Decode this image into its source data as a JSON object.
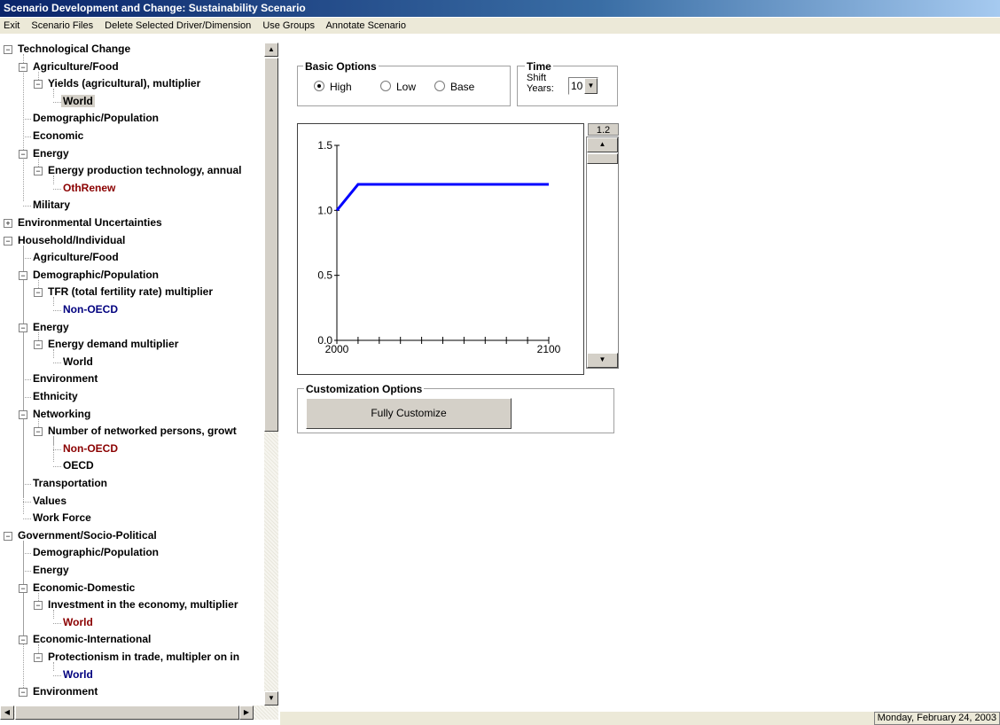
{
  "window": {
    "title": "Scenario Development and Change: Sustainability Scenario"
  },
  "menu": {
    "exit": "Exit",
    "scenario_files": "Scenario Files",
    "delete": "Delete Selected Driver/Dimension",
    "use_groups": "Use Groups",
    "annotate": "Annotate Scenario"
  },
  "tree": {
    "nodes": [
      {
        "label": "Technological Change",
        "depth": 0,
        "expander": "minus",
        "color": "black"
      },
      {
        "label": "Agriculture/Food",
        "depth": 1,
        "expander": "minus",
        "color": "black"
      },
      {
        "label": "Yields (agricultural), multiplier",
        "depth": 2,
        "expander": "minus",
        "color": "black"
      },
      {
        "label": "World",
        "depth": 3,
        "expander": "none",
        "color": "black",
        "selected": true
      },
      {
        "label": "Demographic/Population",
        "depth": 1,
        "expander": "none",
        "color": "black"
      },
      {
        "label": "Economic",
        "depth": 1,
        "expander": "none",
        "color": "black"
      },
      {
        "label": "Energy",
        "depth": 1,
        "expander": "minus",
        "color": "black"
      },
      {
        "label": "Energy production technology, annual",
        "depth": 2,
        "expander": "minus",
        "color": "black"
      },
      {
        "label": "OthRenew",
        "depth": 3,
        "expander": "none",
        "color": "red"
      },
      {
        "label": "Military",
        "depth": 1,
        "expander": "none",
        "color": "black"
      },
      {
        "label": "Environmental Uncertainties",
        "depth": 0,
        "expander": "plus",
        "color": "black"
      },
      {
        "label": "Household/Individual",
        "depth": 0,
        "expander": "minus",
        "color": "black"
      },
      {
        "label": "Agriculture/Food",
        "depth": 1,
        "expander": "none",
        "color": "black"
      },
      {
        "label": "Demographic/Population",
        "depth": 1,
        "expander": "minus",
        "color": "black"
      },
      {
        "label": "TFR (total fertility rate) multiplier",
        "depth": 2,
        "expander": "minus",
        "color": "black"
      },
      {
        "label": "Non-OECD",
        "depth": 3,
        "expander": "none",
        "color": "blue"
      },
      {
        "label": "Energy",
        "depth": 1,
        "expander": "minus",
        "color": "black"
      },
      {
        "label": "Energy demand multiplier",
        "depth": 2,
        "expander": "minus",
        "color": "black"
      },
      {
        "label": "World",
        "depth": 3,
        "expander": "none",
        "color": "black"
      },
      {
        "label": "Environment",
        "depth": 1,
        "expander": "none",
        "color": "black"
      },
      {
        "label": "Ethnicity",
        "depth": 1,
        "expander": "none",
        "color": "black"
      },
      {
        "label": "Networking",
        "depth": 1,
        "expander": "minus",
        "color": "black"
      },
      {
        "label": "Number of networked persons, growt",
        "depth": 2,
        "expander": "minus",
        "color": "black"
      },
      {
        "label": "Non-OECD",
        "depth": 3,
        "expander": "none",
        "color": "red"
      },
      {
        "label": "OECD",
        "depth": 3,
        "expander": "none",
        "color": "black"
      },
      {
        "label": "Transportation",
        "depth": 1,
        "expander": "none",
        "color": "black"
      },
      {
        "label": "Values",
        "depth": 1,
        "expander": "none",
        "color": "black"
      },
      {
        "label": "Work Force",
        "depth": 1,
        "expander": "none",
        "color": "black"
      },
      {
        "label": "Government/Socio-Political",
        "depth": 0,
        "expander": "minus",
        "color": "black"
      },
      {
        "label": "Demographic/Population",
        "depth": 1,
        "expander": "none",
        "color": "black"
      },
      {
        "label": "Energy",
        "depth": 1,
        "expander": "none",
        "color": "black"
      },
      {
        "label": "Economic-Domestic",
        "depth": 1,
        "expander": "minus",
        "color": "black"
      },
      {
        "label": "Investment in the economy, multiplier",
        "depth": 2,
        "expander": "minus",
        "color": "black"
      },
      {
        "label": "World",
        "depth": 3,
        "expander": "none",
        "color": "red"
      },
      {
        "label": "Economic-International",
        "depth": 1,
        "expander": "minus",
        "color": "black"
      },
      {
        "label": "Protectionism in trade, multipler on in",
        "depth": 2,
        "expander": "minus",
        "color": "black"
      },
      {
        "label": "World",
        "depth": 3,
        "expander": "none",
        "color": "blue"
      },
      {
        "label": "Environment",
        "depth": 1,
        "expander": "minus",
        "color": "black"
      }
    ]
  },
  "basic_options": {
    "legend": "Basic Options",
    "options": [
      {
        "label": "High",
        "checked": true
      },
      {
        "label": "Low",
        "checked": false
      },
      {
        "label": "Base",
        "checked": false
      }
    ]
  },
  "time": {
    "legend": "Time",
    "shift_label_1": "Shift",
    "shift_label_2": "Years:",
    "shift_value": "10"
  },
  "slider": {
    "value": "1.2"
  },
  "customization": {
    "legend": "Customization Options",
    "button": "Fully Customize"
  },
  "status": {
    "date": "Monday, February 24, 2003"
  },
  "chart_data": {
    "type": "line",
    "x": [
      2000,
      2010,
      2020,
      2030,
      2040,
      2050,
      2060,
      2070,
      2080,
      2090,
      2100
    ],
    "series": [
      {
        "values": [
          1.0,
          1.2,
          1.2,
          1.2,
          1.2,
          1.2,
          1.2,
          1.2,
          1.2,
          1.2,
          1.2
        ],
        "color": "#0000ff"
      }
    ],
    "y_ticks": [
      "0.0",
      "0.5",
      "1.0",
      "1.5"
    ],
    "x_tick_labels": [
      "2000",
      "2100"
    ],
    "xlim": [
      2000,
      2100
    ],
    "ylim": [
      0,
      1.5
    ],
    "grid": false
  }
}
